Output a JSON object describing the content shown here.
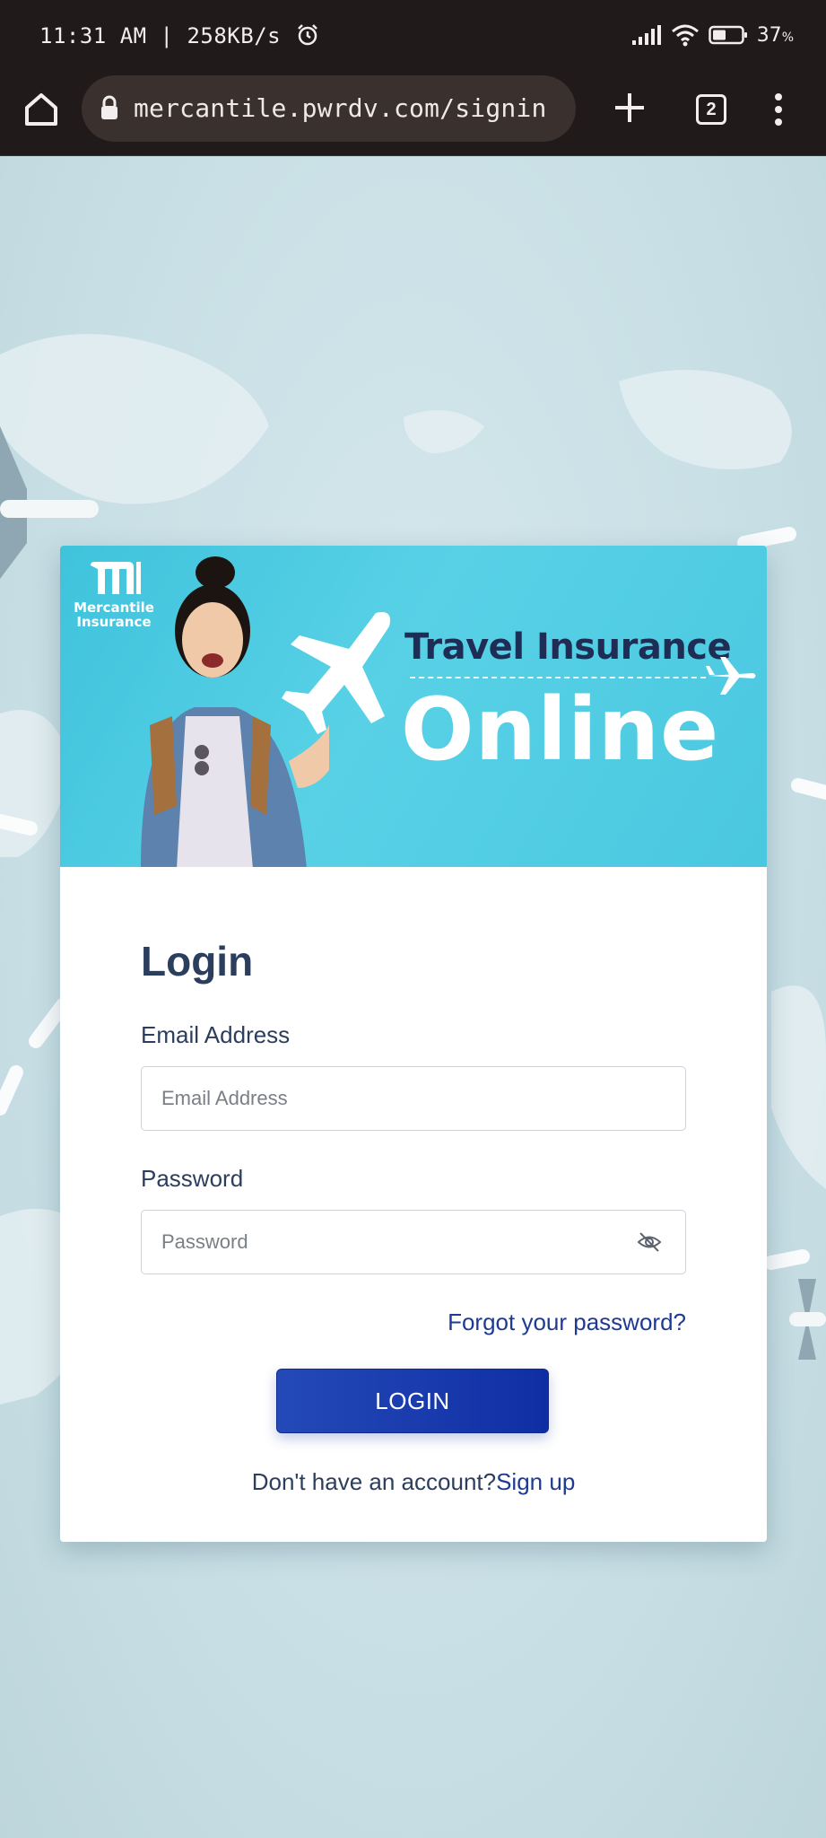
{
  "status_bar": {
    "time": "11:31 AM",
    "speed": "258KB/s",
    "battery": "37"
  },
  "browser": {
    "url": "mercantile.pwrdv.com/signin",
    "tab_count": "2"
  },
  "banner": {
    "logo_line1": "Mercantile",
    "logo_line2": "Insurance",
    "title": "Travel Insurance",
    "subtitle": "Online"
  },
  "form": {
    "heading": "Login",
    "email_label": "Email Address",
    "email_placeholder": "Email Address",
    "email_value": "",
    "password_label": "Password",
    "password_placeholder": "Password",
    "password_value": "",
    "forgot_link": "Forgot your password?",
    "login_button": "LOGIN",
    "signup_prompt": "Don't have an account?",
    "signup_link": "Sign up"
  },
  "colors": {
    "brand_blue": "#1a3cae",
    "banner_cyan": "#4ac8e0",
    "heading_navy": "#2c3e5e"
  }
}
